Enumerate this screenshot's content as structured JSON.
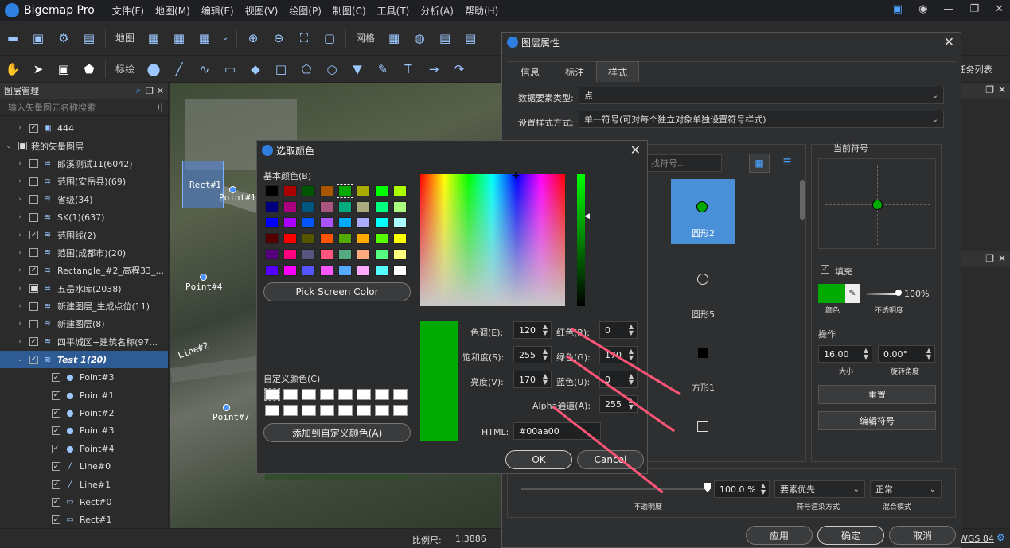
{
  "app": {
    "title": "Bigemap Pro",
    "menu": [
      "文件(F)",
      "地图(M)",
      "编辑(E)",
      "视图(V)",
      "绘图(P)",
      "制图(C)",
      "工具(T)",
      "分析(A)",
      "帮助(H)"
    ]
  },
  "toolbar1": {
    "map_label": "地图",
    "grid_label": "网格"
  },
  "toolbar2": {
    "annot_label": "标绘"
  },
  "left_panel": {
    "title": "图层管理",
    "search_placeholder": "输入矢量图元名称搜索",
    "items": [
      {
        "label": "444",
        "level": 1,
        "checked": true,
        "icon": "image-layer-icon"
      },
      {
        "label": "我的矢量图层",
        "level": 0,
        "checked": "partial",
        "icon": ""
      },
      {
        "label": "郎溪测试11(6042)",
        "level": 1,
        "checked": false,
        "icon": "layers-icon"
      },
      {
        "label": "范围(安岳县)(69)",
        "level": 1,
        "checked": false,
        "icon": "layers-icon"
      },
      {
        "label": "省级(34)",
        "level": 1,
        "checked": false,
        "icon": "layers-icon"
      },
      {
        "label": "SK(1)(637)",
        "level": 1,
        "checked": false,
        "icon": "layers-icon"
      },
      {
        "label": "范围线(2)",
        "level": 1,
        "checked": true,
        "icon": "layers-icon"
      },
      {
        "label": "范围(成都市)(20)",
        "level": 1,
        "checked": false,
        "icon": "layers-icon"
      },
      {
        "label": "Rectangle_#2_高程33_...",
        "level": 1,
        "checked": true,
        "icon": "layers-icon"
      },
      {
        "label": "五岳水库(2038)",
        "level": 1,
        "checked": "partial",
        "icon": "layers-icon"
      },
      {
        "label": "新建图层_生成点位(11)",
        "level": 1,
        "checked": false,
        "icon": "layers-icon"
      },
      {
        "label": "新建图层(8)",
        "level": 1,
        "checked": false,
        "icon": "layers-icon"
      },
      {
        "label": "四平城区+建筑名称(97...",
        "level": 1,
        "checked": true,
        "icon": "layers-icon"
      },
      {
        "label": "Test 1(20)",
        "level": 1,
        "checked": true,
        "icon": "layers-icon",
        "selected": true
      },
      {
        "label": "Point#3",
        "level": 2,
        "checked": true,
        "icon": "point-icon"
      },
      {
        "label": "Point#1",
        "level": 2,
        "checked": true,
        "icon": "point-icon"
      },
      {
        "label": "Point#2",
        "level": 2,
        "checked": true,
        "icon": "point-icon"
      },
      {
        "label": "Point#3",
        "level": 2,
        "checked": true,
        "icon": "point-icon"
      },
      {
        "label": "Point#4",
        "level": 2,
        "checked": true,
        "icon": "point-icon"
      },
      {
        "label": "Line#0",
        "level": 2,
        "checked": true,
        "icon": "line-icon"
      },
      {
        "label": "Line#1",
        "level": 2,
        "checked": true,
        "icon": "line-icon"
      },
      {
        "label": "Rect#0",
        "level": 2,
        "checked": true,
        "icon": "rect-icon"
      },
      {
        "label": "Rect#1",
        "level": 2,
        "checked": true,
        "icon": "rect-icon"
      }
    ]
  },
  "map": {
    "labels": {
      "rect1": "Rect#1",
      "point4": "Point#4",
      "point1": "Point#1",
      "line2": "Line#2",
      "point7": "Point#7"
    }
  },
  "status": {
    "scale_label": "比例尺:",
    "scale_value": "1:3886",
    "crs": "WGS 84"
  },
  "right_side": {
    "task_list": "任务列表"
  },
  "layer_props": {
    "title": "图层属性",
    "tabs": [
      "信息",
      "标注",
      "样式"
    ],
    "active_tab": "样式",
    "type_label": "数据要素类型:",
    "type_value": "点",
    "style_mode_label": "设置样式方式:",
    "style_mode_value": "单一符号(可对每个独立对象单独设置符号样式)",
    "symbol_search": "找符号...",
    "symbols": [
      "圆形2",
      "圆形5",
      "方形1"
    ],
    "current_symbol_title": "当前符号",
    "fill_label": "填充",
    "fill_color": "#00aa00",
    "opacity_value": "100%",
    "color_caption": "颜色",
    "opacity_caption": "不透明度",
    "ops_label": "操作",
    "size_value": "16.00",
    "size_caption": "大小",
    "rotation_value": "0.00°",
    "rotation_caption": "旋转角度",
    "reset_btn": "重置",
    "edit_symbol_btn": "编辑符号",
    "layer_opacity_value": "100.0 %",
    "layer_opacity_caption": "不透明度",
    "render_mode_value": "要素优先",
    "render_mode_caption": "符号渲染方式",
    "blend_value": "正常",
    "blend_caption": "混合模式",
    "apply_btn": "应用",
    "ok_btn": "确定",
    "cancel_btn": "取消"
  },
  "color_dialog": {
    "title": "选取颜色",
    "basic_colors_label": "基本颜色(B)",
    "basic_colors": [
      "#000000",
      "#aa0000",
      "#005500",
      "#aa5500",
      "#00aa00",
      "#aaaa00",
      "#00ff00",
      "#aaff00",
      "#00007f",
      "#aa007f",
      "#00557f",
      "#aa557f",
      "#00aa7f",
      "#aaaa7f",
      "#00ff7f",
      "#aaff7f",
      "#0000ff",
      "#aa00ff",
      "#0055ff",
      "#aa55ff",
      "#00aaff",
      "#aaaaff",
      "#00ffff",
      "#aaffff",
      "#550000",
      "#ff0000",
      "#555500",
      "#ff5500",
      "#55aa00",
      "#ffaa00",
      "#55ff00",
      "#ffff00",
      "#55007f",
      "#ff007f",
      "#55557f",
      "#ff557f",
      "#55aa7f",
      "#ffaa7f",
      "#55ff7f",
      "#ffff7f",
      "#5500ff",
      "#ff00ff",
      "#5555ff",
      "#ff55ff",
      "#55aaff",
      "#ffaaff",
      "#55ffff",
      "#ffffff"
    ],
    "pick_screen_btn": "Pick Screen Color",
    "custom_colors_label": "自定义颜色(C)",
    "add_custom_btn": "添加到自定义颜色(A)",
    "hue_label": "色调(E):",
    "hue": "120",
    "sat_label": "饱和度(S):",
    "sat": "255",
    "val_label": "亮度(V):",
    "val": "170",
    "red_label": "红色(R):",
    "red": "0",
    "green_label": "绿色(G):",
    "green": "170",
    "blue_label": "蓝色(U):",
    "blue": "0",
    "alpha_label": "Alpha通道(A):",
    "alpha": "255",
    "html_label": "HTML:",
    "html": "#00aa00",
    "ok_btn": "OK",
    "cancel_btn": "Cancel",
    "current_color": "#00aa00"
  }
}
